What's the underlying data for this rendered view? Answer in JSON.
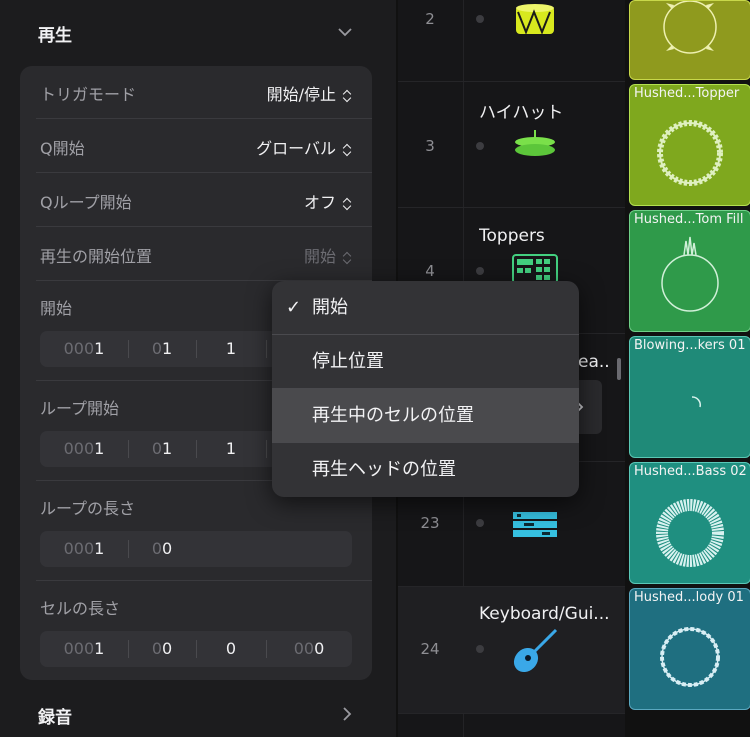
{
  "inspector": {
    "playback_title": "再生",
    "recording_title": "録音",
    "rows": [
      {
        "label": "トリガモード",
        "value": "開始/停止"
      },
      {
        "label": "Q開始",
        "value": "グローバル"
      },
      {
        "label": "Qループ開始",
        "value": "オフ"
      },
      {
        "label": "再生の開始位置",
        "value": "開始"
      }
    ],
    "start_label": "開始",
    "start_fields": [
      {
        "dim": "000",
        "val": "1"
      },
      {
        "dim": "0",
        "val": "1"
      },
      {
        "dim": "",
        "val": "1"
      }
    ],
    "loop_start_label": "ループ開始",
    "loop_start_fields": [
      {
        "dim": "000",
        "val": "1"
      },
      {
        "dim": "0",
        "val": "1"
      },
      {
        "dim": "",
        "val": "1"
      }
    ],
    "loop_length_label": "ループの長さ",
    "loop_length_fields": [
      {
        "dim": "000",
        "val": "1"
      },
      {
        "dim": "0",
        "val": "0"
      }
    ],
    "cell_length_label": "セルの長さ",
    "cell_length_fields": [
      {
        "dim": "000",
        "val": "1"
      },
      {
        "dim": "0",
        "val": "0"
      },
      {
        "dim": "",
        "val": "0"
      },
      {
        "dim": "00",
        "val": "0"
      }
    ]
  },
  "popup_menu": {
    "checkmark": "✓",
    "items": [
      "開始",
      "停止位置",
      "再生中のセルの位置",
      "再生ヘッドの位置"
    ],
    "selected_index": 0,
    "highlighted_index": 2
  },
  "tracks": [
    {
      "number": "2",
      "name": "",
      "icon": "snare-drum-icon"
    },
    {
      "number": "3",
      "name": "ハイハット",
      "icon": "hi-hat-icon"
    },
    {
      "number": "4",
      "name": "Toppers",
      "icon": "drum-machine-icon"
    },
    {
      "number": "",
      "name": "ea...",
      "icon": ""
    },
    {
      "number": "23",
      "name": "",
      "icon": "synth-rack-icon"
    },
    {
      "number": "24",
      "name": "Keyboard/Gui...",
      "icon": "acoustic-guitar-icon"
    }
  ],
  "cells": [
    {
      "label": "",
      "color": "#8f9a1e"
    },
    {
      "label": "Hushed...Topper",
      "color": "#7fa81e"
    },
    {
      "label": "Hushed...Tom Fill",
      "color": "#2f9a4a"
    },
    {
      "label": "Blowing...kers 01",
      "color": "#1f8a78"
    },
    {
      "label": "Hushed...Bass 02",
      "color": "#1f8f80"
    },
    {
      "label": "Hushed...lody 01",
      "color": "#1f6f80"
    }
  ]
}
